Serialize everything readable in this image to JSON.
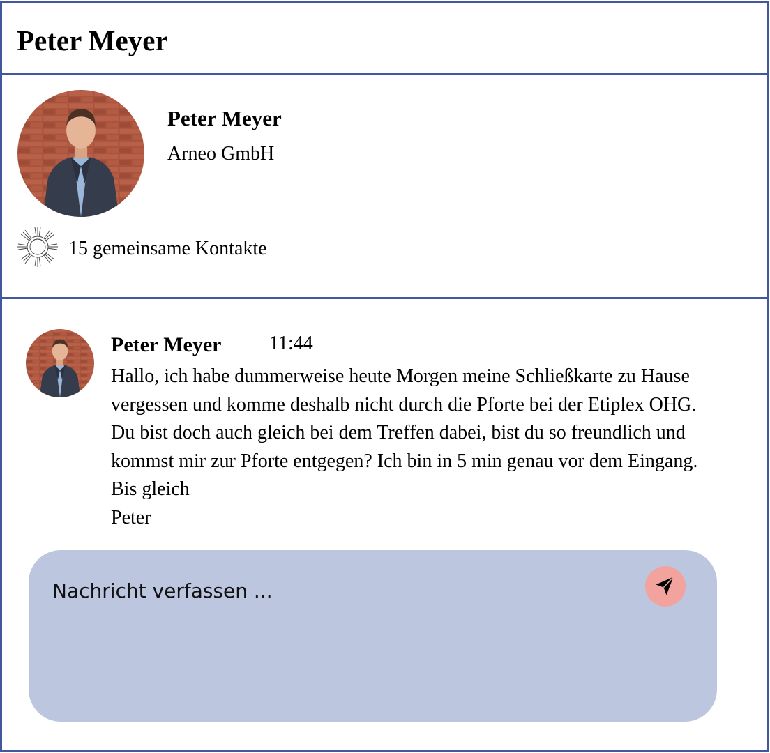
{
  "header": {
    "title": "Peter Meyer"
  },
  "profile": {
    "avatar": "profile-photo",
    "name": "Peter Meyer",
    "company": "Arneo GmbH",
    "contacts_icon": "connected-hands-icon",
    "mutual_contacts": "15 gemeinsame Kontakte"
  },
  "message": {
    "sender": "Peter Meyer",
    "time": "11:44",
    "lines": [
      "Hallo, ich habe dummerweise heute Morgen meine Schließkarte zu Hause",
      "vergessen und komme deshalb nicht durch die Pforte bei der Etiplex OHG.",
      "Du bist doch auch gleich bei dem Treffen dabei, bist du so freundlich und",
      "kommst mir zur Pforte entgegen? Ich bin in 5 min genau vor dem Eingang.",
      "Bis gleich",
      "Peter"
    ]
  },
  "compose": {
    "placeholder": "Nachricht verfassen ...",
    "value": "",
    "send_icon": "paper-plane-icon"
  },
  "colors": {
    "border": "#41589e",
    "compose_bg": "#bdc6df",
    "send_bg": "#f3a39d"
  }
}
